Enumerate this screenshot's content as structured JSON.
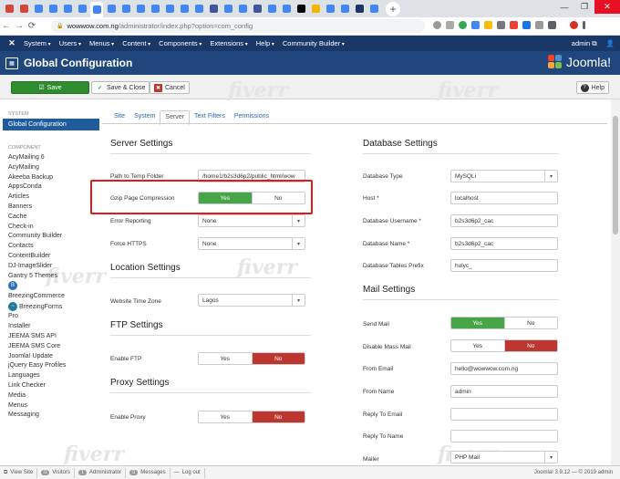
{
  "browser": {
    "tab_colors": [
      "#d44638",
      "#d44638",
      "#4285f4",
      "#4285f4",
      "#4285f4",
      "#4285f4",
      "#4285f4",
      "#4285f4",
      "#4285f4",
      "#4285f4",
      "#4285f4",
      "#4285f4",
      "#4285f4",
      "#4285f4",
      "#3b5998",
      "#4285f4",
      "#4285f4",
      "#3b5998",
      "#4285f4",
      "#4285f4",
      "#000000",
      "#f4b400",
      "#4285f4",
      "#4285f4",
      "#1a3867",
      "#4285f4"
    ],
    "url_host": "wowwow.com.ng",
    "url_path": "/administrator/index.php?option=com_config",
    "win_controls": [
      "—",
      "❐",
      "✕"
    ]
  },
  "topnav": {
    "items": [
      "System",
      "Users",
      "Menus",
      "Content",
      "Components",
      "Extensions",
      "Help",
      "Community Builder"
    ],
    "user": "admin ⧉",
    "user_icon": "👤"
  },
  "header": {
    "title": "Global Configuration",
    "logo_text": "Joomla!",
    "brand_colors": [
      "#f44321",
      "#5091cd",
      "#f9a541",
      "#7ac143"
    ]
  },
  "toolbar": {
    "save": "Save",
    "save_close": "Save & Close",
    "cancel": "Cancel",
    "help": "Help"
  },
  "sidebar": {
    "system_caption": "SYSTEM",
    "selected": "Global Configuration",
    "component_caption": "COMPONENT",
    "items": [
      "AcyMailing 6",
      "AcyMailing",
      "Akeeba Backup",
      "AppsConda",
      "Articles",
      "Banners",
      "Cache",
      "Check-in",
      "Community Builder",
      "Contacts",
      "ContentBuilder",
      "DJ-ImageSlider",
      "Gantry 5 Themes"
    ],
    "bz_commerce": "BreezingCommerce",
    "bz_forms": "BreezingForms",
    "items2": [
      "Pro",
      "Installer",
      "JEEMA SMS API",
      "JEEMA SMS Core",
      "Joomla! Update",
      "jQuery Easy Profiles",
      "Languages",
      "Link Checker",
      "Media",
      "Menus",
      "Messaging"
    ]
  },
  "tabs": [
    "Site",
    "System",
    "Server",
    "Text Filters",
    "Permissions"
  ],
  "server": {
    "heading": "Server Settings",
    "temp_label": "Path to Temp Folder",
    "temp_value": "/home1/b2s3d6p2/public_html/wow",
    "gzip_label": "Gzip Page Compression",
    "error_label": "Error Reporting",
    "error_value": "None",
    "https_label": "Force HTTPS",
    "https_value": "None"
  },
  "location": {
    "heading": "Location Settings",
    "tz_label": "Website Time Zone",
    "tz_value": "Lagos"
  },
  "ftp": {
    "heading": "FTP Settings",
    "enable_label": "Enable FTP"
  },
  "proxy": {
    "heading": "Proxy Settings",
    "enable_label": "Enable Proxy"
  },
  "database": {
    "heading": "Database Settings",
    "type_label": "Database Type",
    "type_value": "MySQLi",
    "host_label": "Host *",
    "host_value": "localhost",
    "user_label": "Database Username *",
    "user_value": "b2s3d6p2_cac",
    "name_label": "Database Name *",
    "name_value": "b2s3d6p2_cac",
    "prefix_label": "Database Tables Prefix",
    "prefix_value": "hulyc_"
  },
  "mail": {
    "heading": "Mail Settings",
    "send_label": "Send Mail",
    "disable_label": "Disable Mass Mail",
    "from_email_label": "From Email",
    "from_email_value": "hello@wowwow.com.ng",
    "from_name_label": "From Name",
    "from_name_value": "admin",
    "reply_email_label": "Reply To Email",
    "reply_name_label": "Reply To Name",
    "mailer_label": "Mailer",
    "mailer_value": "PHP Mail"
  },
  "toggle": {
    "yes": "Yes",
    "no": "No"
  },
  "status": {
    "view_site": "View Site",
    "visitors_count": "0",
    "visitors": "Visitors",
    "admin_count": "1",
    "admin": "Administrator",
    "messages_count": "0",
    "messages": "Messages",
    "logout": "Log out",
    "version": "Joomla! 3.9.12 — © 2019 admin"
  },
  "watermark": "fiverr"
}
